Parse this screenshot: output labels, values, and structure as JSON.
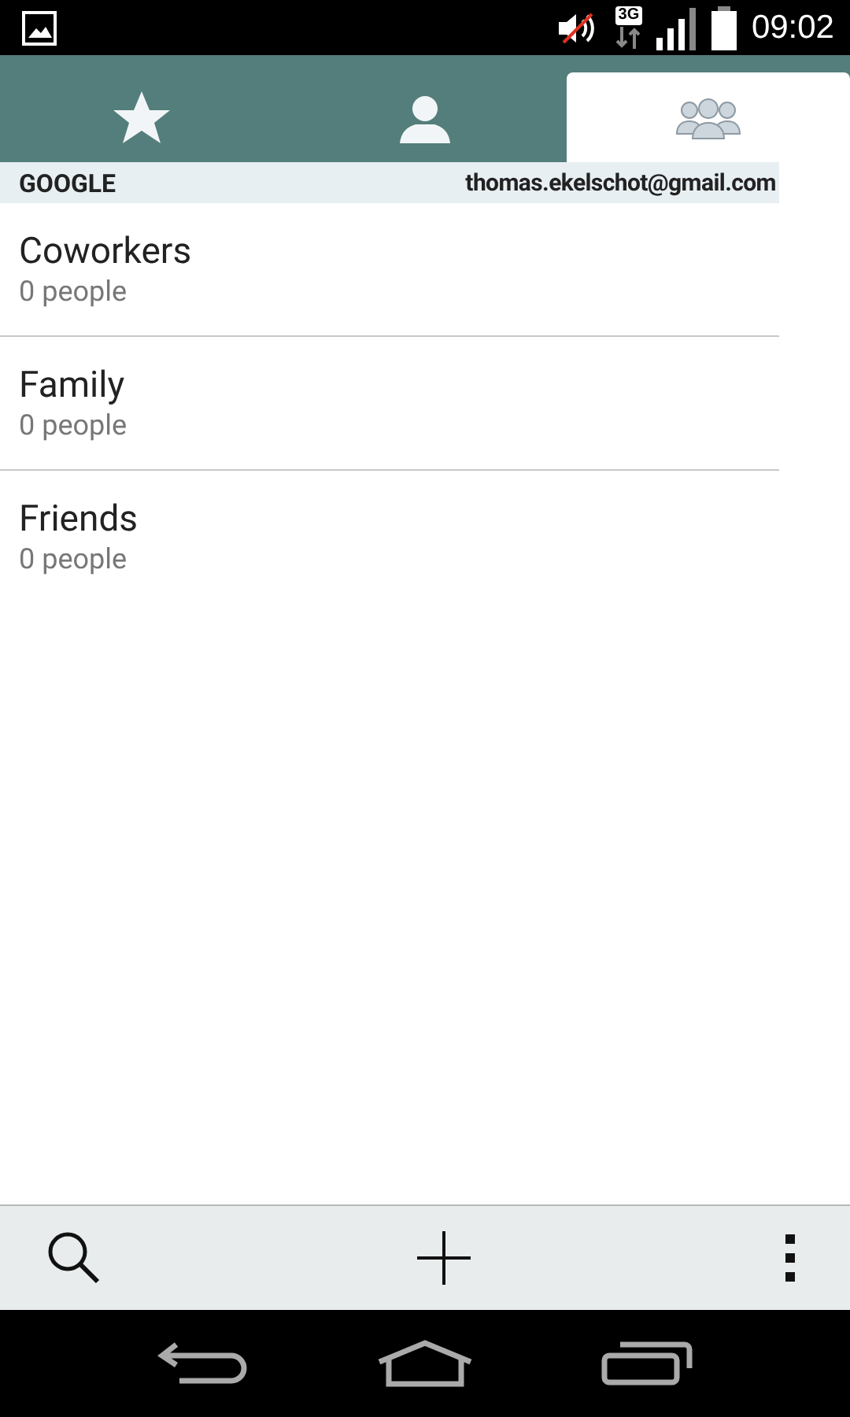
{
  "status_bar": {
    "network": "3G",
    "time": "09:02"
  },
  "tabs": [
    {
      "kind": "favorites",
      "selected": false
    },
    {
      "kind": "contacts",
      "selected": false
    },
    {
      "kind": "groups",
      "selected": true
    }
  ],
  "account": {
    "type": "GOOGLE",
    "email": "thomas.ekelschot@gmail.com"
  },
  "groups": [
    {
      "name": "Coworkers",
      "count": "0 people"
    },
    {
      "name": "Family",
      "count": "0 people"
    },
    {
      "name": "Friends",
      "count": "0 people"
    }
  ]
}
